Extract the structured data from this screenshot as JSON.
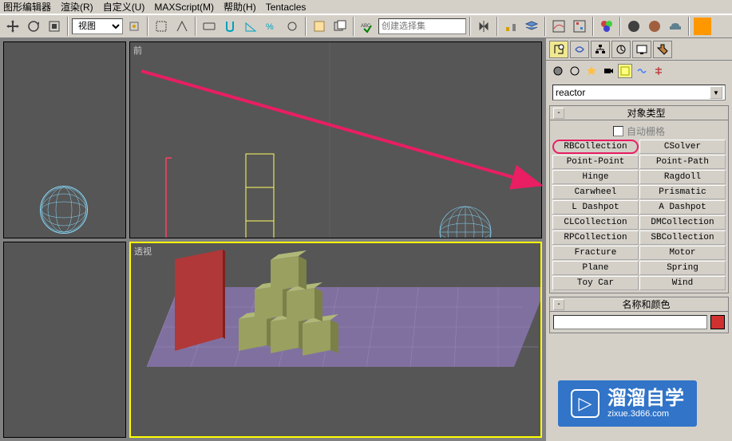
{
  "menu": {
    "graph_editor": "图形编辑器",
    "render": "渲染(R)",
    "customize": "自定义(U)",
    "maxscript": "MAXScript(M)",
    "help": "帮助(H)",
    "tentacles": "Tentacles"
  },
  "toolbar": {
    "view_dropdown": "视图",
    "selection_set": "创建选择集"
  },
  "viewports": {
    "top_left_label": "",
    "front_label": "前",
    "perspective_label": "透视",
    "left_label": ""
  },
  "panel": {
    "category": "reactor",
    "autogrid_label": "自动栅格",
    "rollout_objtype_title": "对象类型",
    "rollout_namecolor_title": "名称和颜色",
    "buttons": [
      [
        "RBCollection",
        "CSolver"
      ],
      [
        "Point-Point",
        "Point-Path"
      ],
      [
        "Hinge",
        "Ragdoll"
      ],
      [
        "Carwheel",
        "Prismatic"
      ],
      [
        "L Dashpot",
        "A Dashpot"
      ],
      [
        "CLCollection",
        "DMCollection"
      ],
      [
        "RPCollection",
        "SBCollection"
      ],
      [
        "Fracture",
        "Motor"
      ],
      [
        "Plane",
        "Spring"
      ],
      [
        "Toy Car",
        "Wind"
      ]
    ]
  },
  "watermark": {
    "title": "溜溜自学",
    "url": "zixue.3d66.com"
  }
}
